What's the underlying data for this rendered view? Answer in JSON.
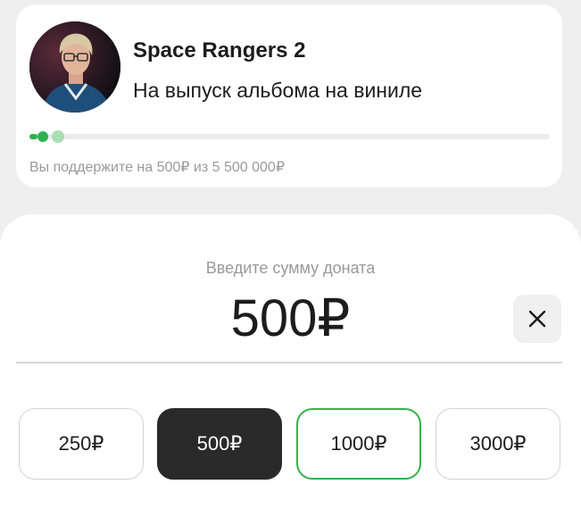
{
  "project": {
    "title": "Space Rangers 2",
    "goal": "На выпуск альбома на виниле",
    "support_text": "Вы поддержите на 500₽ из 5 500 000₽",
    "progress_fraction": 0.04
  },
  "donation": {
    "input_label": "Введите сумму доната",
    "amount": "500₽",
    "presets": [
      "250₽",
      "500₽",
      "1000₽",
      "3000₽"
    ],
    "selected_index": 1,
    "highlighted_index": 2
  },
  "colors": {
    "accent_green": "#2db34f",
    "selected_dark": "#2a2a2a"
  },
  "icons": {
    "clear": "close-icon"
  }
}
